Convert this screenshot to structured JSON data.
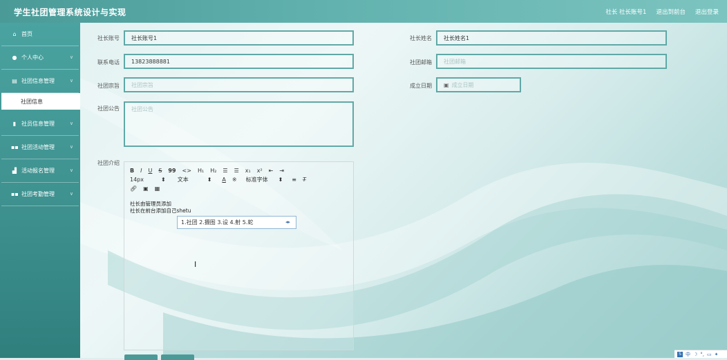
{
  "header": {
    "title": "学生社团管理系统设计与实现",
    "user": "社长 社长账号1",
    "front_link": "退出到前台",
    "logout": "退出登录"
  },
  "sidebar": {
    "items": [
      {
        "label": "首页",
        "icon": "home-icon",
        "has_chevron": false
      },
      {
        "label": "个人中心",
        "icon": "user-icon",
        "has_chevron": true
      },
      {
        "label": "社团信息管理",
        "icon": "table-icon",
        "has_chevron": true,
        "expanded": true,
        "sub": "社团信息"
      },
      {
        "label": "社员信息管理",
        "icon": "badge-icon",
        "has_chevron": true
      },
      {
        "label": "社团活动管理",
        "icon": "grid-icon",
        "has_chevron": true
      },
      {
        "label": "活动报名管理",
        "icon": "chart-icon",
        "has_chevron": true
      },
      {
        "label": "社团考勤管理",
        "icon": "grid-icon",
        "has_chevron": true
      }
    ]
  },
  "form": {
    "account_label": "社长账号",
    "account_value": "社长账号1",
    "name_label": "社长姓名",
    "name_value": "社长姓名1",
    "phone_label": "联系电话",
    "phone_value": "13823888881",
    "email_label": "社团邮箱",
    "email_placeholder": "社团邮箱",
    "motto_label": "社团宗旨",
    "motto_placeholder": "社团宗旨",
    "date_label": "成立日期",
    "date_placeholder": "成立日期",
    "notice_label": "社团公告",
    "notice_placeholder": "社团公告",
    "intro_label": "社团介绍"
  },
  "editor": {
    "row1": [
      "B",
      "I",
      "U",
      "S",
      "99",
      "<>",
      "H₁",
      "H₂",
      "☰",
      "☰",
      "x₁",
      "x²",
      "⇤",
      "⇥"
    ],
    "font_size": "14px",
    "text_style": "文本",
    "font_family": "标准字体",
    "content_line1": "社长由管理员添加",
    "content_line2": "社长在前台添加自己shetu"
  },
  "ime": {
    "candidates": "1.社团  2.摄图  3.设  4.射  5.蛇"
  },
  "tray": {
    "lang": "中"
  },
  "colors": {
    "accent": "#4a9a98",
    "border": "#5fa8a6"
  }
}
